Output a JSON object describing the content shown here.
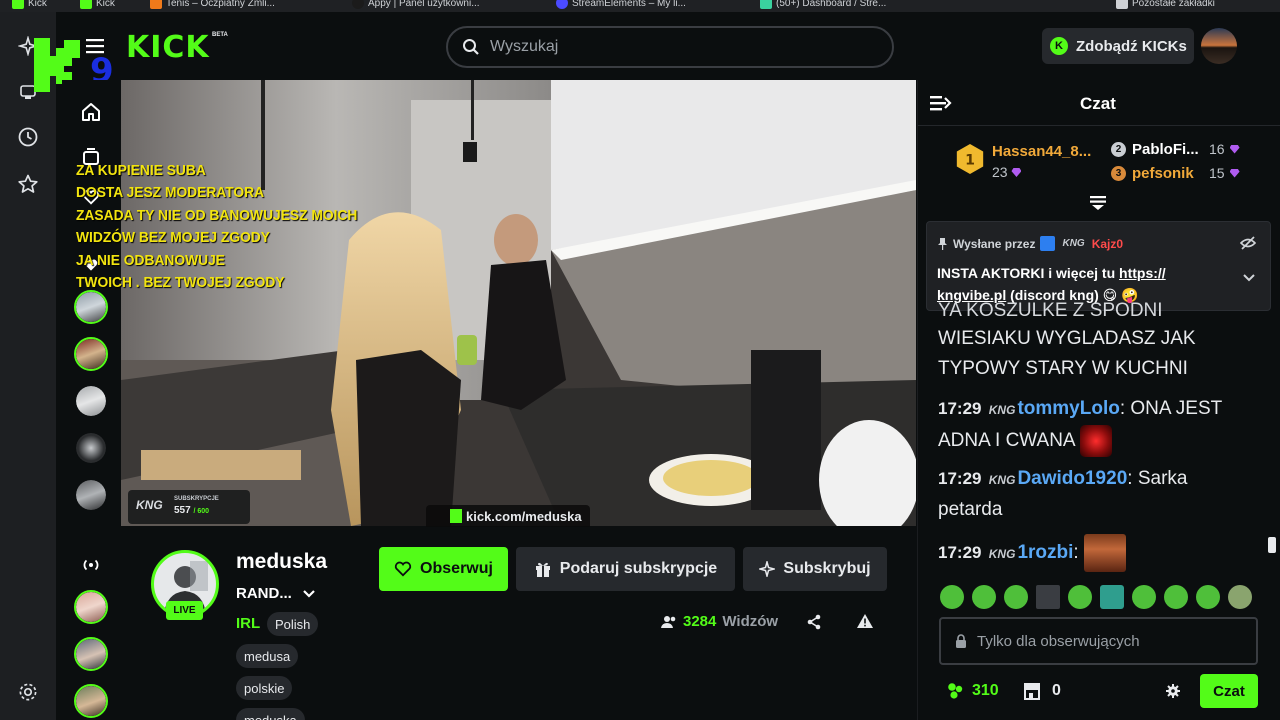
{
  "browser": {
    "bookmarks": [
      "Kick",
      "Kick",
      "Tenis – Oczpiatny Zmli...",
      "Appy | Panel użytkowni...",
      "StreamElements – My li...",
      "(50+) Dashboard / Stre...",
      "Pozostałe zakładki"
    ]
  },
  "topnav": {
    "logo": "KICK",
    "beta": "BETA",
    "search_placeholder": "Wyszukaj",
    "kicks_button": "Zdobądź KICKs"
  },
  "overlay": {
    "lines": [
      "ZA KUPIENIE SUBA",
      "DOSTA JESZ MODERATORA",
      "ZASADA  TY NIE OD BANOWUJESZ MOICH",
      "WIDZÓW BEZ MOJEJ ZGODY",
      "JA NIE ODBANOWUJE",
      "TWOICH . BEZ TWOJEJ ZGODY"
    ],
    "sub_widget_label": "SUBSKRYPCJE",
    "sub_widget_count": "557",
    "sub_widget_goal": "/ 600",
    "kng_logo": "KNG",
    "url": "kick.com/meduska"
  },
  "channel": {
    "name": "meduska",
    "title": "RAND...",
    "live": "LIVE",
    "category": "IRL",
    "tags": [
      "Polish",
      "medusa",
      "polskie",
      "meduska"
    ],
    "follow": "Obserwuj",
    "gift": "Podaruj subskrypcje",
    "subscribe": "Subskrybuj",
    "viewers": "3284",
    "viewers_label": "Widzów"
  },
  "chat": {
    "title": "Czat",
    "leaderboard": {
      "first_name": "Hassan44_8...",
      "first_count": "23",
      "second_rank": "2",
      "second_name": "PabloFi...",
      "second_count": "16",
      "third_rank": "3",
      "third_name": "pefsonik",
      "third_count": "15",
      "first_rank": "1"
    },
    "pinned": {
      "sent_by": "Wysłane przez",
      "user": "Kajz0",
      "text_prefix": "INSTA AKTORKI i więcej tu ",
      "link": "https://\nkngvibe.pl",
      "link_line1": "https://",
      "link_line2": "kngvibe.pl",
      "text_suffix": " (discord kng) 😋 🤪"
    },
    "messages": [
      {
        "time": "",
        "user": "",
        "text": "YA KOSZULKE Z SPODNI"
      },
      {
        "time": "",
        "user": "",
        "text": "WIESIAKU WYGLADASZ JAK TYPOWY STARY W KUCHNI"
      },
      {
        "time": "17:29",
        "user": "tommyLolo",
        "text": ": ONA JEST ADNA I CWANA"
      },
      {
        "time": "17:29",
        "user": "Dawido1920",
        "text": ": Sarka petarda"
      },
      {
        "time": "17:29",
        "user": "1rozbi",
        "text": ":"
      }
    ],
    "badge": "KNG",
    "input_placeholder": "Tylko dla obserwujących",
    "points": "310",
    "store_count": "0",
    "send": "Czat"
  },
  "colors": {
    "accent": "#53fc18",
    "bg": "#0b0e0f",
    "user_blue": "#5aa8f5",
    "user_orange": "#f1a93a",
    "overlay_yellow": "#f2e40f"
  }
}
